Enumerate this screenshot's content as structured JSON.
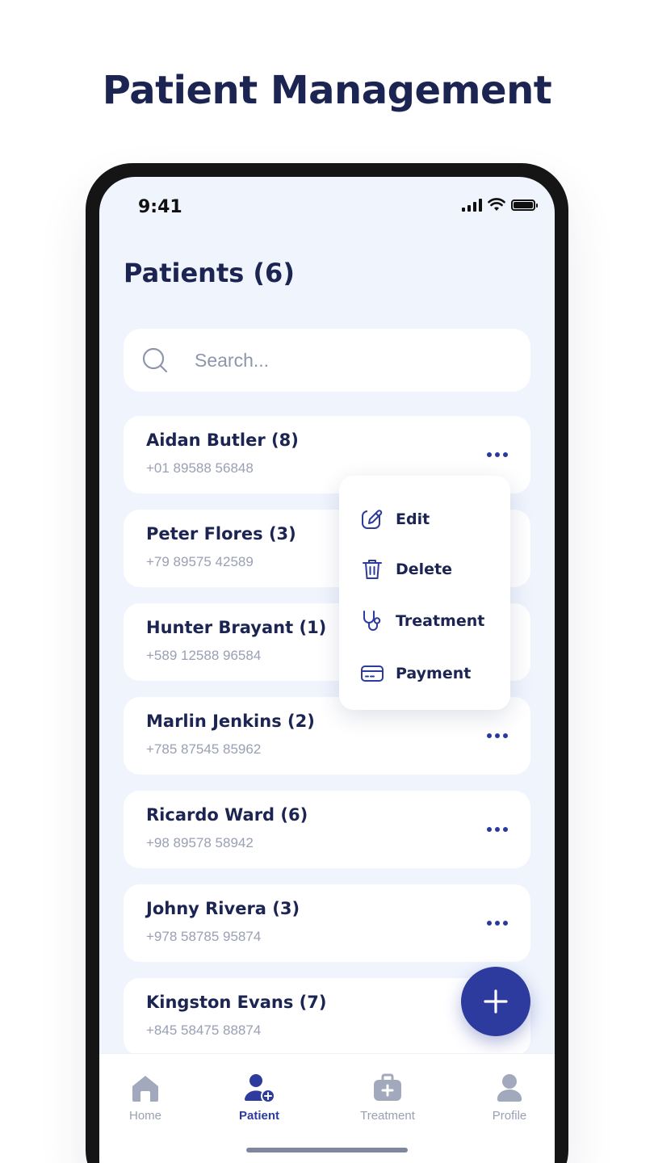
{
  "headline": "Patient Management",
  "status_bar": {
    "time": "9:41"
  },
  "page": {
    "title": "Patients (6)"
  },
  "search": {
    "placeholder": "Search...",
    "icon": "search-icon"
  },
  "patients": [
    {
      "name": "Aidan Butler (8)",
      "phone": "+01 89588 56848"
    },
    {
      "name": "Peter Flores (3)",
      "phone": "+79 89575 42589"
    },
    {
      "name": "Hunter Brayant (1)",
      "phone": "+589 12588 96584"
    },
    {
      "name": "Marlin Jenkins (2)",
      "phone": "+785 87545 85962"
    },
    {
      "name": "Ricardo Ward (6)",
      "phone": "+98 89578 58942"
    },
    {
      "name": "Johny Rivera (3)",
      "phone": "+978 58785 95874"
    },
    {
      "name": "Kingston Evans (7)",
      "phone": "+845 58475 88874"
    }
  ],
  "context_menu": {
    "items": [
      {
        "label": "Edit",
        "icon": "edit-icon"
      },
      {
        "label": "Delete",
        "icon": "trash-icon"
      },
      {
        "label": "Treatment",
        "icon": "stethoscope-icon"
      },
      {
        "label": "Payment",
        "icon": "credit-card-icon"
      }
    ]
  },
  "bottom_nav": {
    "items": [
      {
        "label": "Home",
        "icon": "home-icon",
        "active": false
      },
      {
        "label": "Patient",
        "icon": "patient-add-icon",
        "active": true
      },
      {
        "label": "Treatment",
        "icon": "medical-kit-icon",
        "active": false
      },
      {
        "label": "Profile",
        "icon": "user-icon",
        "active": false
      }
    ]
  },
  "colors": {
    "primary": "#2d3b9e",
    "text_dark": "#1c2452",
    "text_muted": "#9aa0b4",
    "screen_bg": "#eff4fd",
    "nav_inactive": "#a3a9bc"
  }
}
